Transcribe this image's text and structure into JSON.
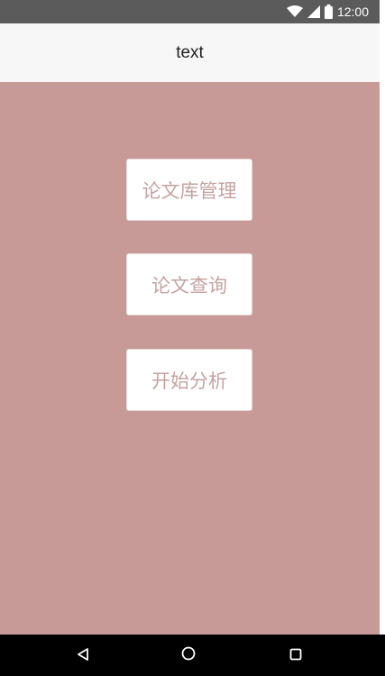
{
  "status_bar": {
    "time": "12:00",
    "icons": [
      "wifi-icon",
      "signal-icon",
      "battery-icon"
    ]
  },
  "app_bar": {
    "title": "text"
  },
  "menu": {
    "buttons": [
      {
        "label": "论文库管理"
      },
      {
        "label": "论文查询"
      },
      {
        "label": "开始分析"
      }
    ]
  },
  "nav_bar": {
    "icons": [
      "back-icon",
      "home-icon",
      "recent-apps-icon"
    ]
  },
  "colors": {
    "content_background": "#c79a98",
    "status_bar": "#5b5b5b",
    "app_bar": "#f7f7f7",
    "button_text": "#c3a3a0",
    "nav_bar": "#000000"
  }
}
